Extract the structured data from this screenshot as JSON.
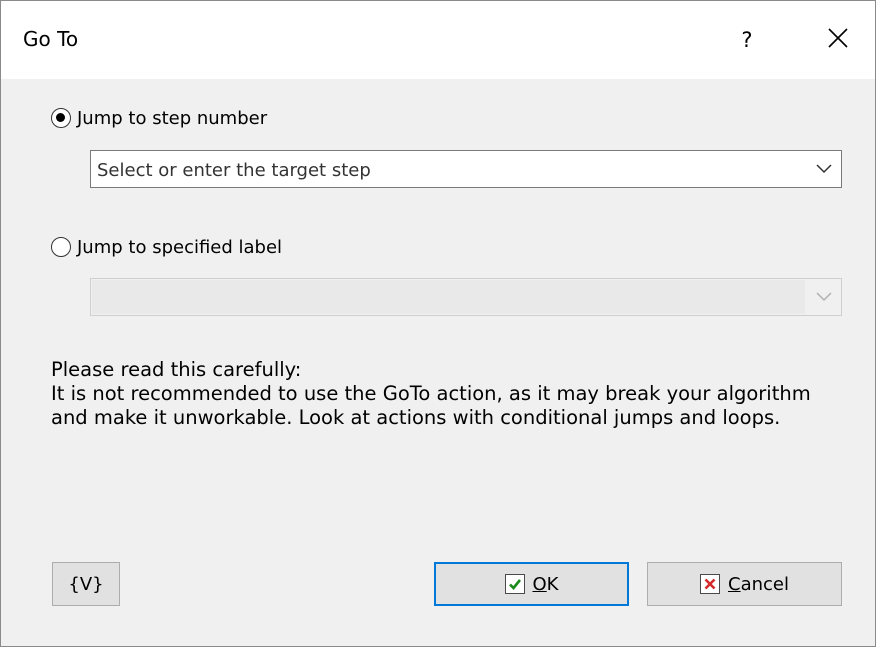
{
  "window": {
    "title": "Go To",
    "help_label": "?",
    "close_icon": "close-icon"
  },
  "option_step": {
    "label": "Jump to step number",
    "selected": true,
    "placeholder": "Select or enter the target step"
  },
  "option_label": {
    "label": "Jump to specified label",
    "selected": false,
    "value": ""
  },
  "notice": {
    "heading": "Please read this carefully:",
    "body": "It is not recommended to use the GoTo action, as it may break your algorithm and make it unworkable. Look at actions with conditional jumps and loops."
  },
  "buttons": {
    "variables": "{V}",
    "ok_mnemonic": "O",
    "ok_rest": "K",
    "cancel_mnemonic": "C",
    "cancel_rest": "ancel"
  },
  "colors": {
    "accent": "#0078d7",
    "ok_check": "#1a8a1a",
    "cancel_x": "#d42a2a",
    "dialog_bg": "#f0f0f0"
  }
}
